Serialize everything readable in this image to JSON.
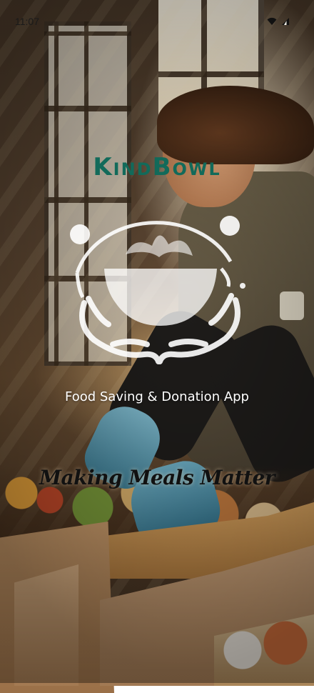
{
  "status_bar": {
    "time": "11:07",
    "icons": [
      "wifi-icon",
      "signal-icon"
    ]
  },
  "brand": {
    "title": "KindBowl",
    "logo_icon": "bowl-in-hands-logo",
    "tagline": "Food Saving & Donation App",
    "slogan": "Making Meals Matter"
  },
  "colors": {
    "brand_title": "#126a5a",
    "logo": "#ffffff",
    "tagline": "#ffffff",
    "slogan": "#111111"
  }
}
